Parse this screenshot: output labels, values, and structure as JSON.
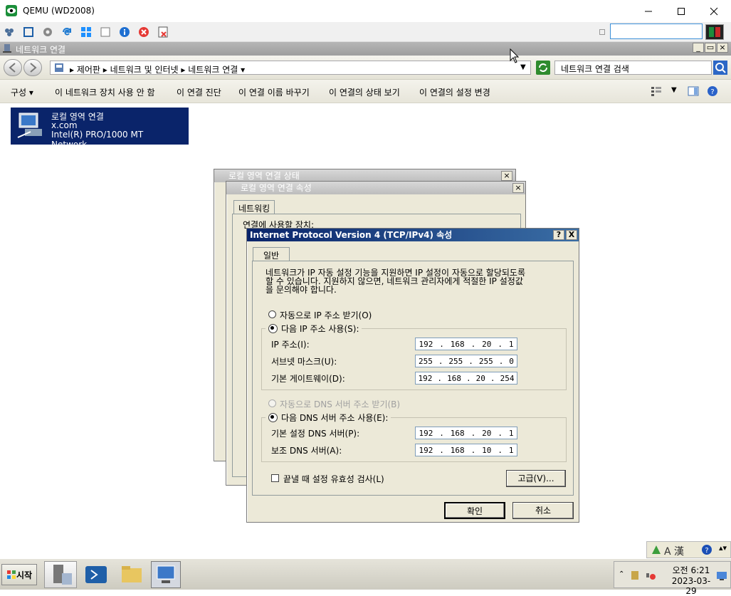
{
  "host": {
    "title": "QEMU (WD2008)",
    "controls": [
      "minimize",
      "maximize",
      "close"
    ]
  },
  "guest_window": {
    "title": "네트워크 연결",
    "breadcrumb": [
      "제어판",
      "네트워크 및 인터넷",
      "네트워크 연결"
    ],
    "search_placeholder": "네트워크 연결 검색",
    "commands": [
      "구성",
      "이 네트워크 장치 사용 안 함",
      "이 연결 진단",
      "이 연결 이름 바꾸기",
      "이 연결의 상태 보기",
      "이 연결의 설정 변경"
    ]
  },
  "connection": {
    "name": "로컬 영역 연결",
    "domain": "x.com",
    "adapter": "Intel(R) PRO/1000 MT Network..."
  },
  "status_dialog": {
    "title": "로컬 영역 연결 상태"
  },
  "props_dialog": {
    "title": "로컬 영역 연결 속성",
    "tab": "네트워킹",
    "partial_label": "연결에 사용할 장치:"
  },
  "ipv4_dialog": {
    "title": "Internet Protocol Version 4 (TCP/IPv4) 속성",
    "help_btn": "?",
    "close_btn": "X",
    "tab": "일반",
    "description_line1": "네트워크가 IP 자동 설정 기능을 지원하면 IP 설정이 자동으로 할당되도록",
    "description_line2": "할 수 있습니다. 지원하지 않으면, 네트워크 관리자에게 적절한 IP 설정값",
    "description_line3": "을 문의해야 합니다.",
    "auto_ip": "자동으로 IP 주소 받기(O)",
    "manual_ip": "다음 IP 주소 사용(S):",
    "ip_label": "IP 주소(I):",
    "ip": [
      "192",
      "168",
      "20",
      "1"
    ],
    "mask_label": "서브넷 마스크(U):",
    "mask": [
      "255",
      "255",
      "255",
      "0"
    ],
    "gateway_label": "기본 게이트웨이(D):",
    "gateway": [
      "192",
      "168",
      "20",
      "254"
    ],
    "auto_dns": "자동으로 DNS 서버 주소 받기(B)",
    "manual_dns": "다음 DNS 서버 주소 사용(E):",
    "dns1_label": "기본 설정 DNS 서버(P):",
    "dns1": [
      "192",
      "168",
      "20",
      "1"
    ],
    "dns2_label": "보조 DNS 서버(A):",
    "dns2": [
      "192",
      "168",
      "10",
      "1"
    ],
    "validate_label": "끝낼 때 설정 유효성 검사(L)",
    "advanced_btn": "고급(V)...",
    "ok_btn": "확인",
    "cancel_btn": "취소"
  },
  "taskbar": {
    "start": "시작",
    "clock_time": "오전 6:21",
    "clock_date": "2023-03-29",
    "lang_ime": "A 漢"
  }
}
